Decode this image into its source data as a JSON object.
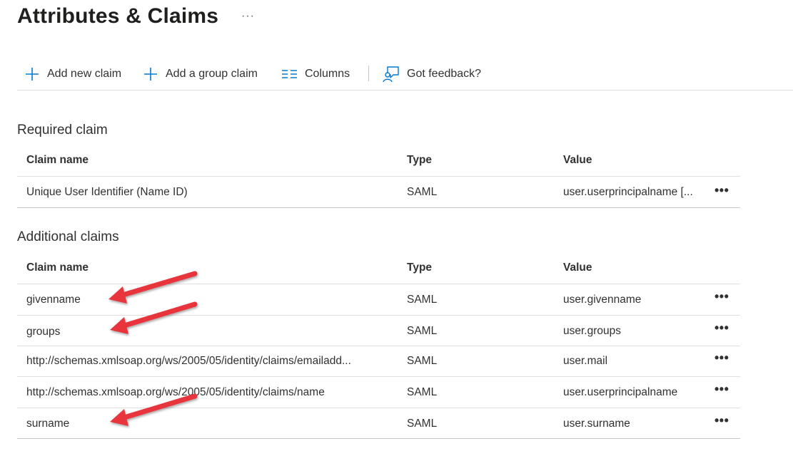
{
  "page": {
    "title": "Attributes & Claims",
    "more_label": "···"
  },
  "toolbar": {
    "add_claim": "Add new claim",
    "add_group_claim": "Add a group claim",
    "columns": "Columns",
    "feedback": "Got feedback?"
  },
  "required": {
    "title": "Required claim",
    "headers": {
      "name": "Claim name",
      "type": "Type",
      "value": "Value"
    },
    "rows": [
      {
        "name": "Unique User Identifier (Name ID)",
        "type": "SAML",
        "value": "user.userprincipalname [...",
        "more": "•••"
      }
    ]
  },
  "additional": {
    "title": "Additional claims",
    "headers": {
      "name": "Claim name",
      "type": "Type",
      "value": "Value"
    },
    "rows": [
      {
        "name": "givenname",
        "type": "SAML",
        "value": "user.givenname",
        "more": "•••"
      },
      {
        "name": "groups",
        "type": "SAML",
        "value": "user.groups",
        "more": "•••"
      },
      {
        "name": "http://schemas.xmlsoap.org/ws/2005/05/identity/claims/emailadd...",
        "type": "SAML",
        "value": "user.mail",
        "more": "•••"
      },
      {
        "name": "http://schemas.xmlsoap.org/ws/2005/05/identity/claims/name",
        "type": "SAML",
        "value": "user.userprincipalname",
        "more": "•••"
      },
      {
        "name": "surname",
        "type": "SAML",
        "value": "user.surname",
        "more": "•••"
      }
    ]
  },
  "colors": {
    "accent": "#0078d4",
    "annotation_arrow": "#e8363d"
  },
  "icons": {
    "add": "plus-icon",
    "columns": "columns-icon",
    "feedback": "feedback-icon"
  }
}
